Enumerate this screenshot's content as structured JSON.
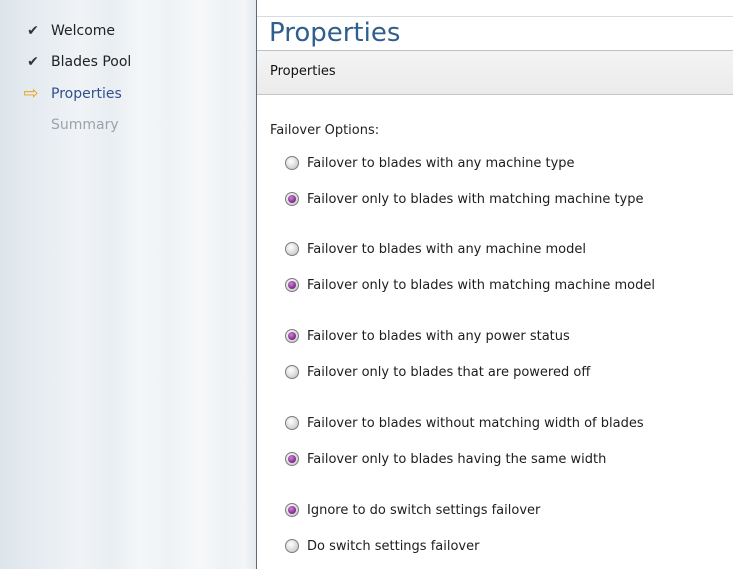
{
  "wizard": {
    "steps": [
      {
        "label": "Welcome",
        "state": "done",
        "icon": "checkmark-icon"
      },
      {
        "label": "Blades Pool",
        "state": "done",
        "icon": "checkmark-icon"
      },
      {
        "label": "Properties",
        "state": "current",
        "icon": "arrow-right-icon"
      },
      {
        "label": "Summary",
        "state": "pending",
        "icon": ""
      }
    ]
  },
  "page": {
    "title": "Properties",
    "subtitle": "Properties",
    "section_label": "Failover Options:"
  },
  "options": [
    {
      "label": "Failover to blades with any machine type",
      "selected": false
    },
    {
      "label": "Failover only to blades with matching machine type",
      "selected": true
    },
    {
      "label": "Failover to blades with any machine model",
      "selected": false
    },
    {
      "label": "Failover only to blades with matching machine model",
      "selected": true
    },
    {
      "label": "Failover to blades with any power status",
      "selected": true
    },
    {
      "label": "Failover only to blades that are powered off",
      "selected": false
    },
    {
      "label": "Failover to blades without matching width of blades",
      "selected": false
    },
    {
      "label": "Failover only to blades having the same width",
      "selected": true
    },
    {
      "label": "Ignore to do switch settings failover",
      "selected": true
    },
    {
      "label": "Do switch settings failover",
      "selected": false
    }
  ],
  "colors": {
    "title": "#2f5f8f",
    "current_step": "#30508e",
    "current_arrow": "#e8a21a",
    "radio_selected": "#8a2f96"
  }
}
